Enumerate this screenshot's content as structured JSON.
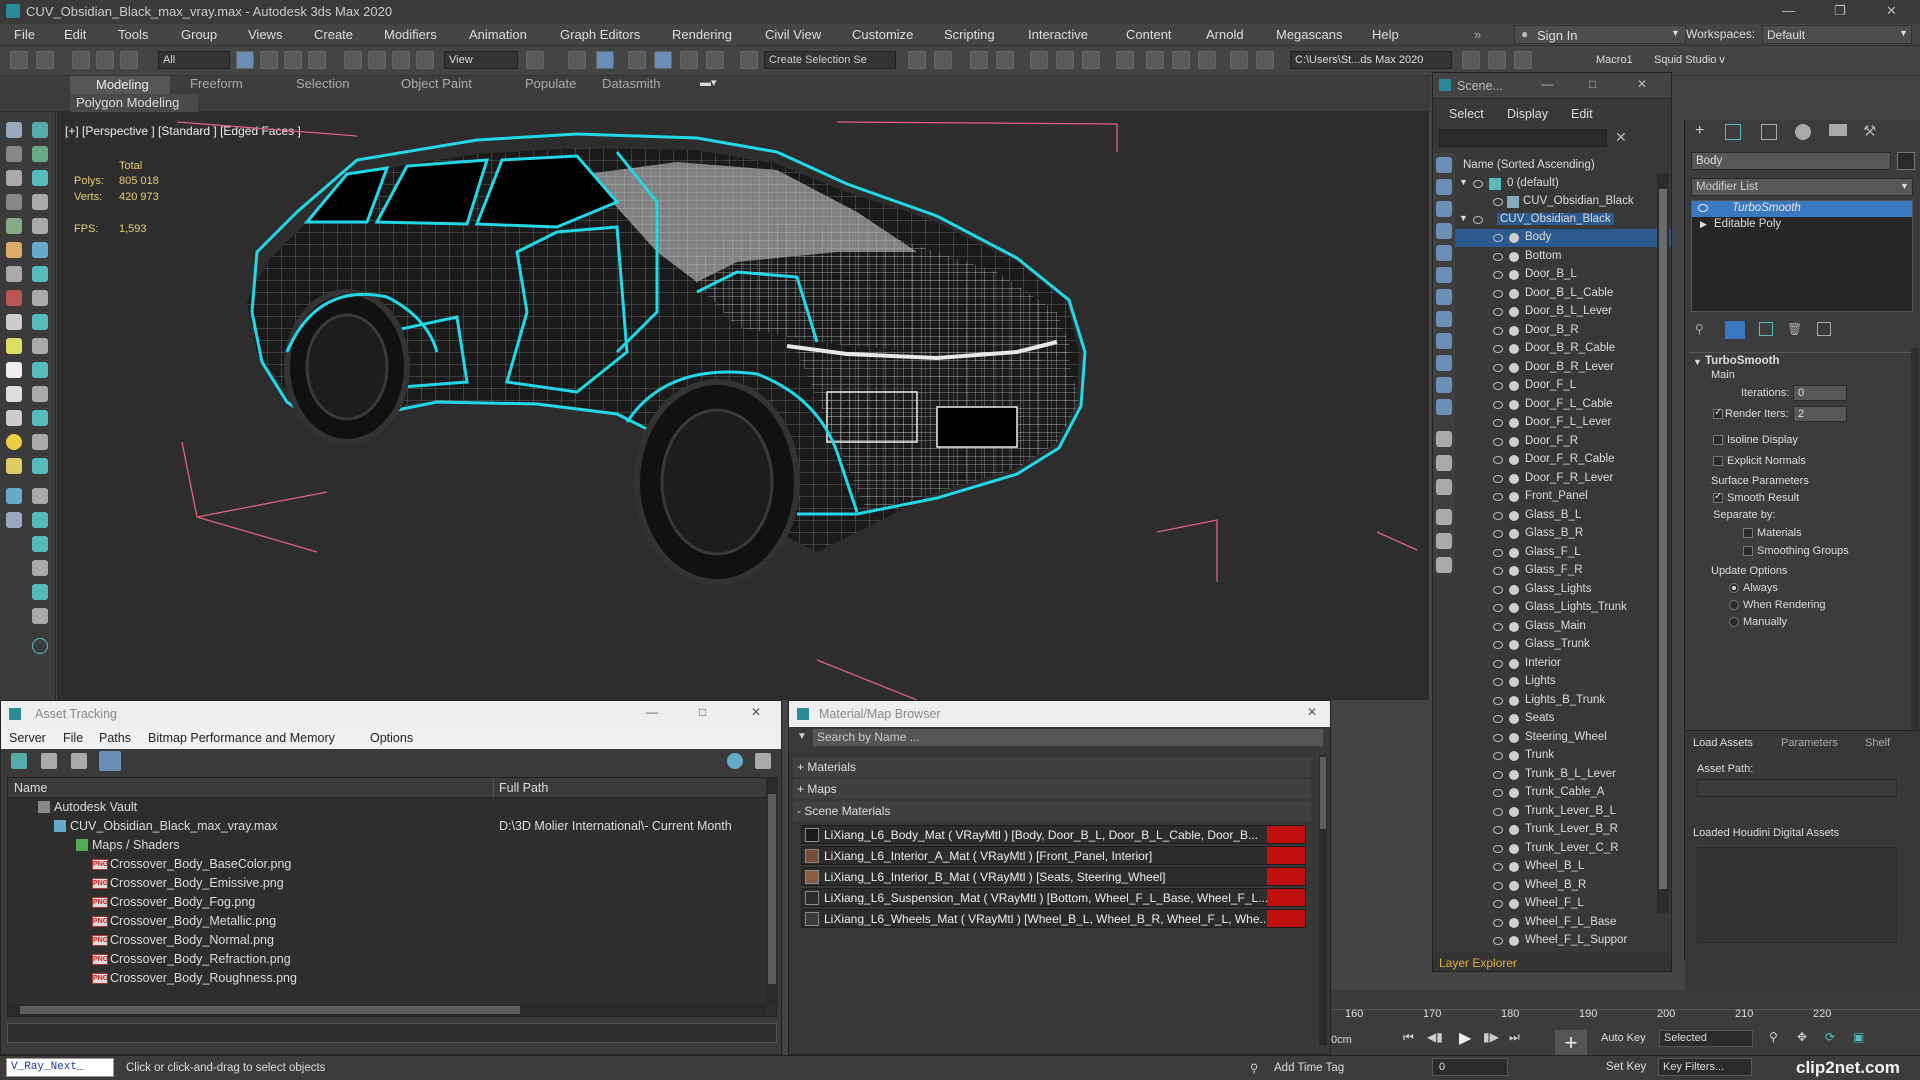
{
  "window": {
    "title": "CUV_Obsidian_Black_max_vray.max - Autodesk 3ds Max 2020"
  },
  "menu": {
    "items": [
      "File",
      "Edit",
      "Tools",
      "Group",
      "Views",
      "Create",
      "Modifiers",
      "Animation",
      "Graph Editors",
      "Rendering",
      "Civil View",
      "Customize",
      "Scripting",
      "Interactive",
      "Content",
      "Arnold",
      "Megascans",
      "Help"
    ],
    "sign_in": "Sign In",
    "workspaces_label": "Workspaces:",
    "workspaces_value": "Default"
  },
  "toolbar": {
    "filter_value": "All",
    "view_value": "View",
    "selection_set_placeholder": "Create Selection Se",
    "path_value": "C:\\Users\\St...ds Max 2020",
    "macro": "Macro1",
    "squid": "Squid Studio v"
  },
  "ribbon": {
    "tabs": [
      "Modeling",
      "Freeform",
      "Selection",
      "Object Paint",
      "Populate",
      "Datasmith"
    ],
    "sub": "Polygon Modeling"
  },
  "viewport": {
    "label": "[+] [Perspective ] [Standard ] [Edged Faces ]",
    "stats": {
      "total_label": "Total",
      "polys_label": "Polys:",
      "polys_value": "805 018",
      "verts_label": "Verts:",
      "verts_value": "420 973",
      "fps_label": "FPS:",
      "fps_value": "1,593"
    }
  },
  "scene_explorer": {
    "title": "Scene...",
    "menu": [
      "Select",
      "Display",
      "Edit"
    ],
    "column_header": "Name (Sorted Ascending)",
    "root": "0 (default)",
    "group_1": "CUV_Obsidian_Black",
    "group_2": "CUV_Obsidian_Black",
    "objects": [
      "Body",
      "Bottom",
      "Door_B_L",
      "Door_B_L_Cable",
      "Door_B_L_Lever",
      "Door_B_R",
      "Door_B_R_Cable",
      "Door_B_R_Lever",
      "Door_F_L",
      "Door_F_L_Cable",
      "Door_F_L_Lever",
      "Door_F_R",
      "Door_F_R_Cable",
      "Door_F_R_Lever",
      "Front_Panel",
      "Glass_B_L",
      "Glass_B_R",
      "Glass_F_L",
      "Glass_F_R",
      "Glass_Lights",
      "Glass_Lights_Trunk",
      "Glass_Main",
      "Glass_Trunk",
      "Interior",
      "Lights",
      "Lights_B_Trunk",
      "Seats",
      "Steering_Wheel",
      "Trunk",
      "Trunk_B_L_Lever",
      "Trunk_Cable_A",
      "Trunk_Lever_B_L",
      "Trunk_Lever_B_R",
      "Trunk_Lever_C_R",
      "Wheel_B_L",
      "Wheel_B_R",
      "Wheel_F_L",
      "Wheel_F_L_Base",
      "Wheel_F_L_Suppor"
    ],
    "footer": "Layer Explorer"
  },
  "command_panel": {
    "object_name": "Body",
    "modifier_list": "Modifier List",
    "stack": [
      "TurboSmooth",
      "Editable Poly"
    ],
    "rollout_title": "TurboSmooth",
    "main_label": "Main",
    "iterations_label": "Iterations:",
    "iterations_value": "0",
    "render_iters_label": "Render Iters:",
    "render_iters_value": "2",
    "isoline_label": "Isoline Display",
    "explicit_label": "Explicit Normals",
    "surface_label": "Surface Parameters",
    "smooth_label": "Smooth Result",
    "separate_label": "Separate by:",
    "materials_label": "Materials",
    "smoothing_label": "Smoothing Groups",
    "update_label": "Update Options",
    "always_label": "Always",
    "when_render_label": "When Rendering",
    "manually_label": "Manually",
    "tabs": [
      "Load Assets",
      "Parameters",
      "Shelf"
    ],
    "asset_path_label": "Asset Path:",
    "houdini_label": "Loaded Houdini Digital Assets"
  },
  "asset_tracking": {
    "title": "Asset Tracking",
    "menu": [
      "Server",
      "File",
      "Paths",
      "Bitmap Performance and Memory",
      "Options"
    ],
    "col_name": "Name",
    "col_path": "Full Path",
    "vault": "Autodesk Vault",
    "file": "CUV_Obsidian_Black_max_vray.max",
    "file_path": "D:\\3D Molier International\\- Current Month",
    "maps": "Maps / Shaders",
    "bitmaps": [
      "Crossover_Body_BaseColor.png",
      "Crossover_Body_Emissive.png",
      "Crossover_Body_Fog.png",
      "Crossover_Body_Metallic.png",
      "Crossover_Body_Normal.png",
      "Crossover_Body_Refraction.png",
      "Crossover_Body_Roughness.png"
    ]
  },
  "material_browser": {
    "title": "Material/Map Browser",
    "search_placeholder": "Search by Name ...",
    "sections": [
      "+ Materials",
      "+ Maps",
      "- Scene Materials"
    ],
    "materials": [
      {
        "text": "LiXiang_L6_Body_Mat ( VRayMtl ) [Body, Door_B_L, Door_B_L_Cable, Door_B...",
        "swatch": "#1a1a1a"
      },
      {
        "text": "LiXiang_L6_Interior_A_Mat ( VRayMtl ) [Front_Panel, Interior]",
        "swatch": "#7a4a3a"
      },
      {
        "text": "LiXiang_L6_Interior_B_Mat ( VRayMtl ) [Seats, Steering_Wheel]",
        "swatch": "#8a5a44"
      },
      {
        "text": "LiXiang_L6_Suspension_Mat ( VRayMtl ) [Bottom, Wheel_F_L_Base, Wheel_F_L...",
        "swatch": "#2a2a2a"
      },
      {
        "text": "LiXiang_L6_Wheels_Mat ( VRayMtl ) [Wheel_B_L, Wheel_B_R, Wheel_F_L, Whe...",
        "swatch": "#3a3a3a"
      }
    ]
  },
  "timeline": {
    "ticks": [
      "160",
      "170",
      "180",
      "190",
      "200",
      "210",
      "220"
    ],
    "auto_key": "Auto Key",
    "set_key": "Set Key",
    "selected": "Selected",
    "key_filters": "Key Filters...",
    "frame": "0",
    "cm": "0cm"
  },
  "status": {
    "script": "V_Ray_Next_",
    "hint": "Click or click-and-drag to select objects",
    "add_time_tag": "Add Time Tag",
    "watermark": "clip2net.com"
  },
  "colors": {
    "wire_cyan": "#22d8e8",
    "selection_blue": "#2c5a8f",
    "stats_yellow": "#e8d070",
    "material_red": "#c01010"
  }
}
